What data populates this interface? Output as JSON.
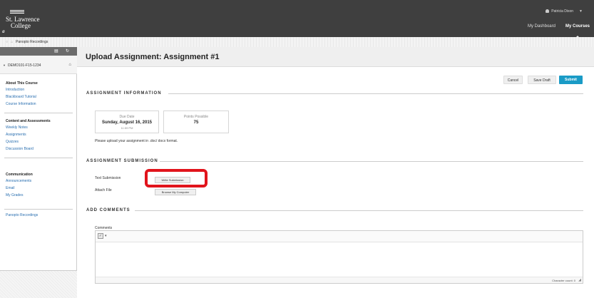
{
  "header": {
    "college_line1": "St. Lawrence",
    "college_line2": "College",
    "user_name": "Patricia Dixon",
    "tabs": [
      "My Dashboard",
      "My Courses"
    ]
  },
  "breadcrumb": {
    "label": "Panopto Recordings"
  },
  "sidebar": {
    "course_id": "DEMO101-F15-1234",
    "sections": [
      {
        "heading": "About This Course",
        "items": [
          "Introduction",
          "Blackboard Tutorial",
          "Course Information"
        ]
      },
      {
        "heading": "Content and Assessments",
        "items": [
          "Weekly Notes",
          "Assignments",
          "Quizzes",
          "Discussion Board"
        ]
      },
      {
        "heading": "Communication",
        "items": [
          "Announcements",
          "Email",
          "My Grades"
        ]
      },
      {
        "heading": "",
        "items": [
          "Panopto Recordings"
        ]
      }
    ]
  },
  "page": {
    "title": "Upload Assignment: Assignment #1",
    "buttons": {
      "cancel": "Cancel",
      "save_draft": "Save Draft",
      "submit": "Submit"
    },
    "assignment_info": {
      "title": "ASSIGNMENT INFORMATION",
      "due_label": "Due Date",
      "due_date": "Sunday, August 16, 2015",
      "due_time": "11:59 PM",
      "points_label": "Points Possible",
      "points": "75",
      "instructions": "Please upload your assignment in .doc/ docx format."
    },
    "submission": {
      "title": "ASSIGNMENT SUBMISSION",
      "text_label": "Text Submission",
      "write_button": "Write Submission",
      "attach_label": "Attach File",
      "browse_button": "Browse My Computer"
    },
    "comments": {
      "title": "ADD COMMENTS",
      "label": "Comments",
      "char_count": "Character count: 0"
    }
  },
  "colors": {
    "header": "#3f3f3f",
    "submit": "#1a9bc6",
    "link": "#2a6fb0",
    "highlight": "#e1141c"
  }
}
